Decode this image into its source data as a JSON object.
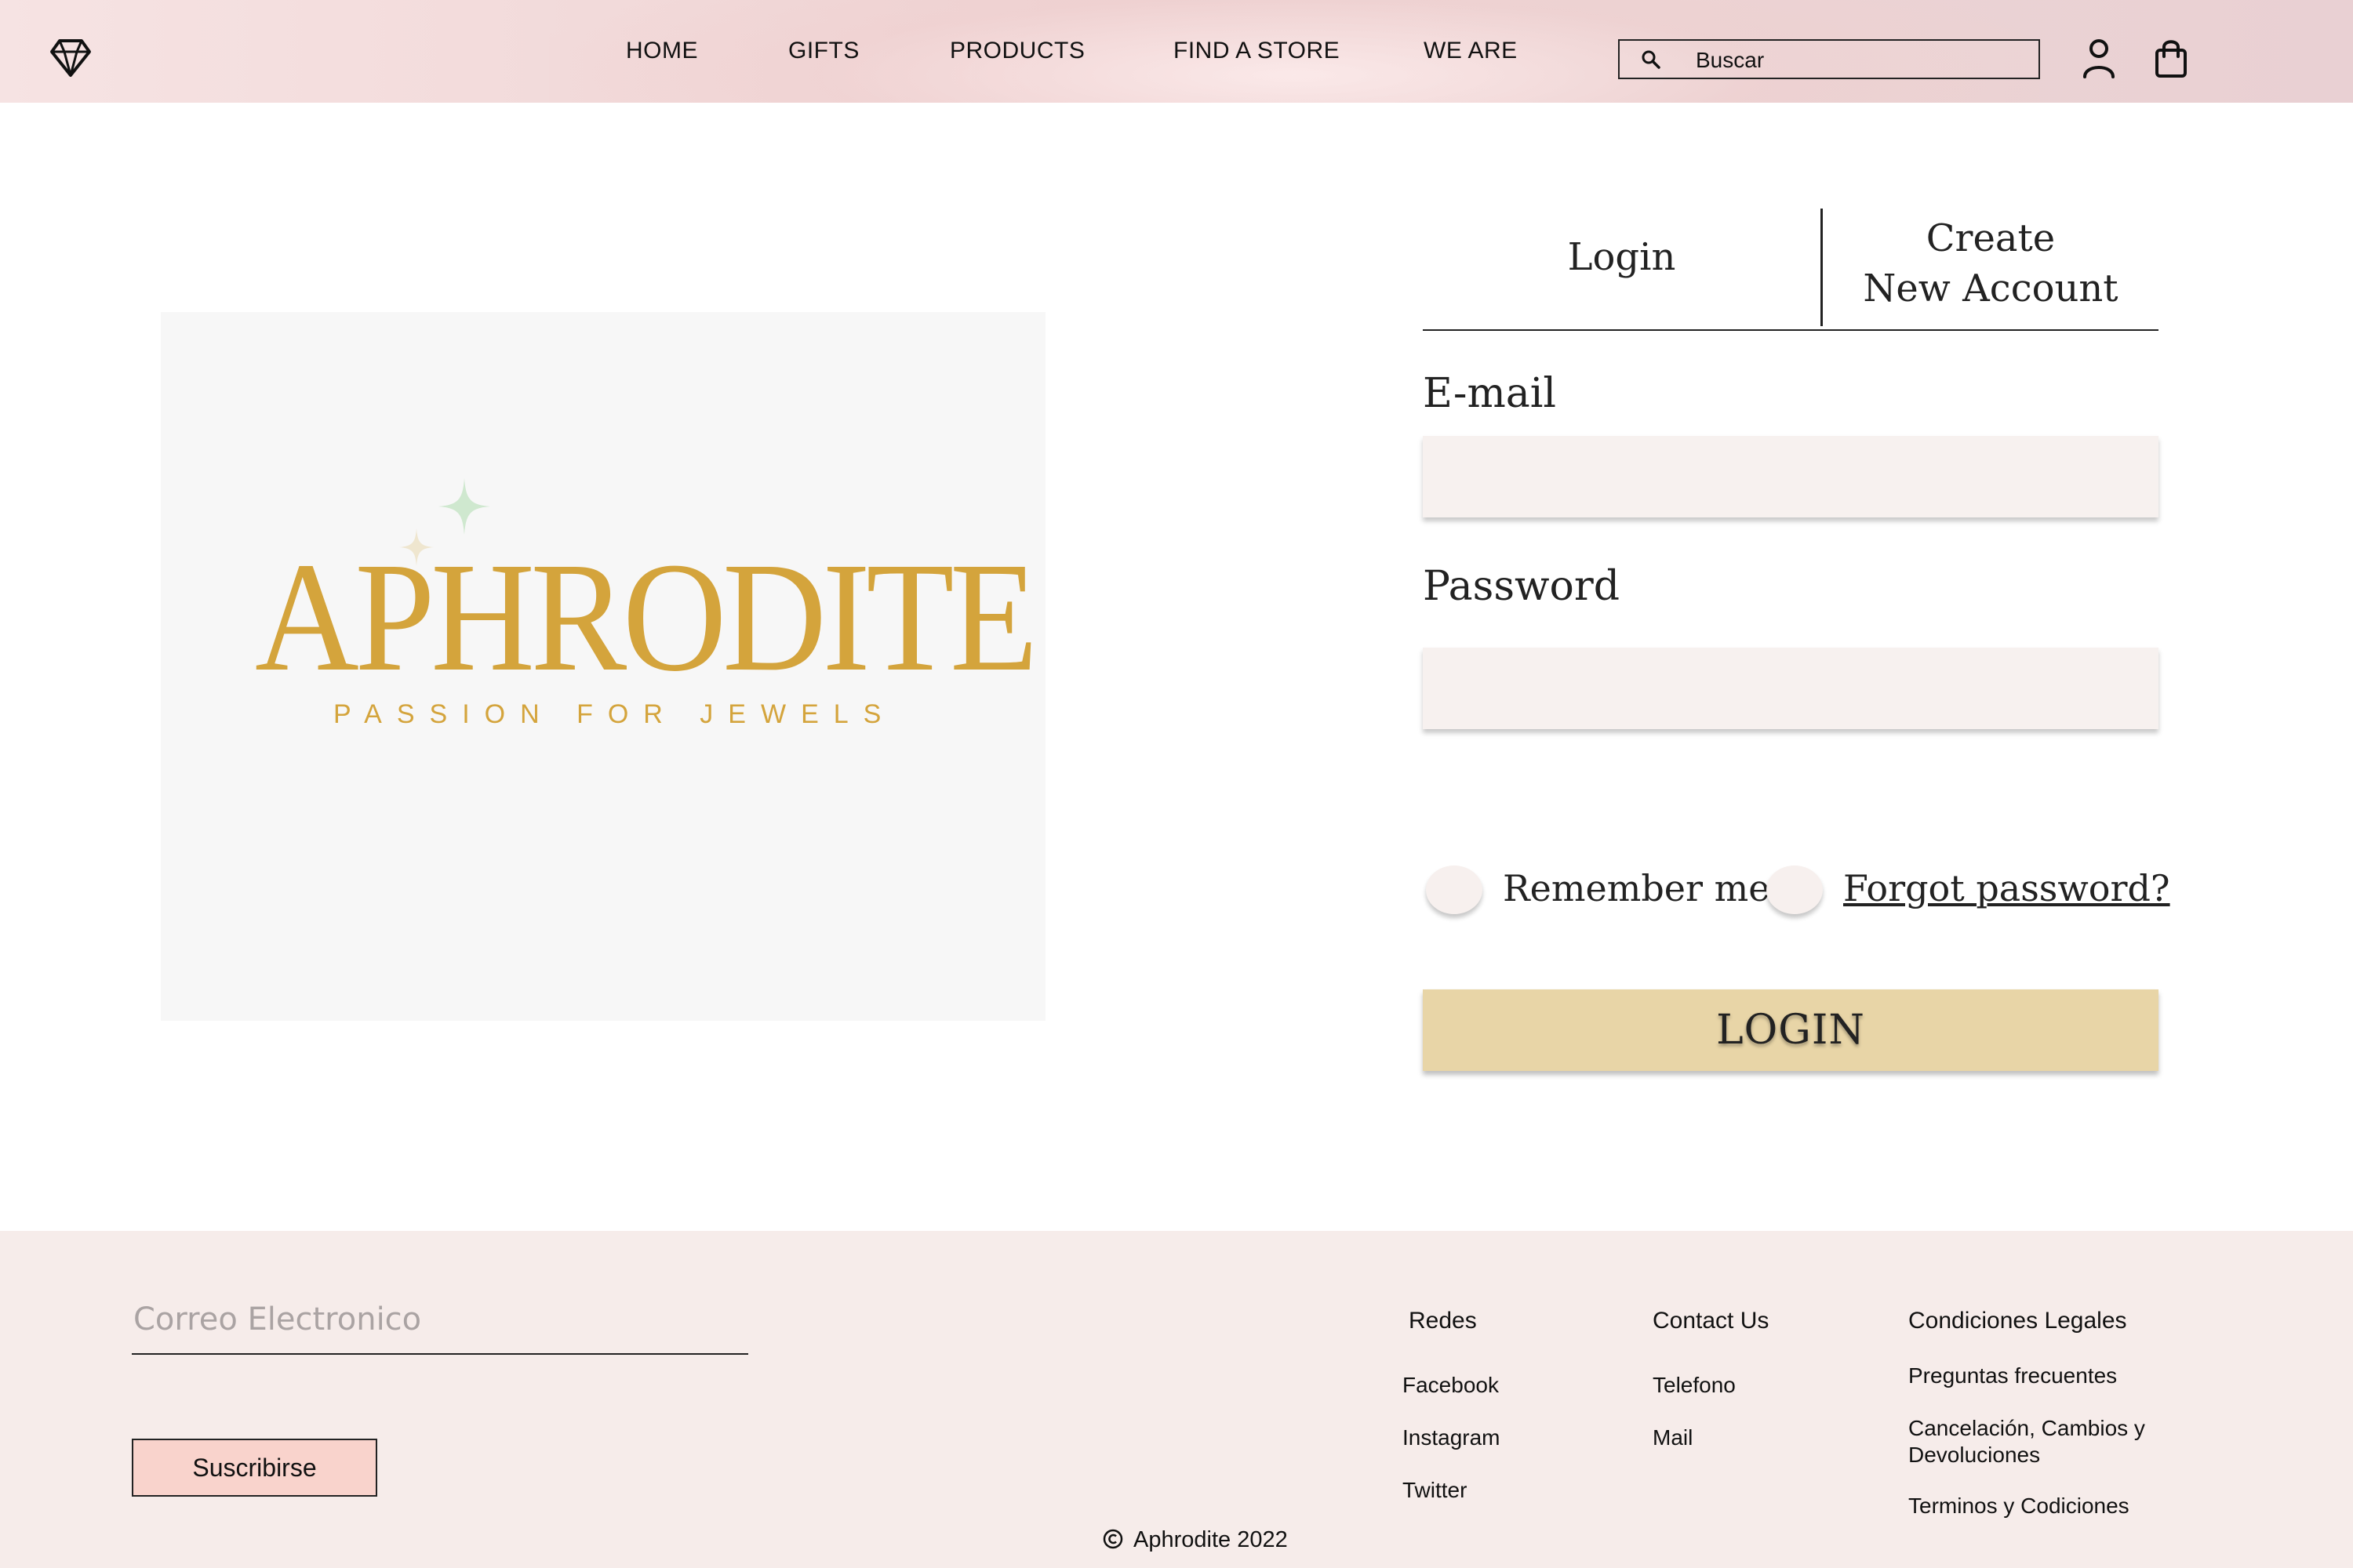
{
  "header": {
    "nav": [
      "HOME",
      "GIFTS",
      "PRODUCTS",
      "FIND A STORE",
      "WE ARE"
    ],
    "search_placeholder": "Buscar",
    "icons": [
      "diamond-icon",
      "search-icon",
      "user-icon",
      "shopping-bag-icon"
    ]
  },
  "brand": {
    "name": "APHRODITE",
    "tagline": "PASSION FOR JEWELS",
    "accent_color": "#d4a43c"
  },
  "auth": {
    "tabs": {
      "login": "Login",
      "create_line1": "Create",
      "create_line2": "New Account"
    },
    "email_label": "E-mail",
    "password_label": "Password",
    "remember_label": "Remember me",
    "forgot_label": "Forgot password?",
    "login_button": "LOGIN",
    "button_color": "#e8d5a7"
  },
  "footer": {
    "email_placeholder": "Correo Electronico",
    "subscribe_label": "Suscribirse",
    "columns": [
      {
        "title": "Redes",
        "links": [
          "Facebook",
          "Instagram",
          "Twitter"
        ]
      },
      {
        "title": "Contact Us",
        "links": [
          "Telefono",
          "Mail"
        ]
      },
      {
        "title": "Condiciones Legales",
        "links": [
          "Preguntas frecuentes",
          "Cancelación, Cambios y Devoluciones",
          "Terminos y Codiciones"
        ]
      }
    ],
    "copyright": "Aphrodite 2022",
    "background_color": "#f6ecea"
  }
}
